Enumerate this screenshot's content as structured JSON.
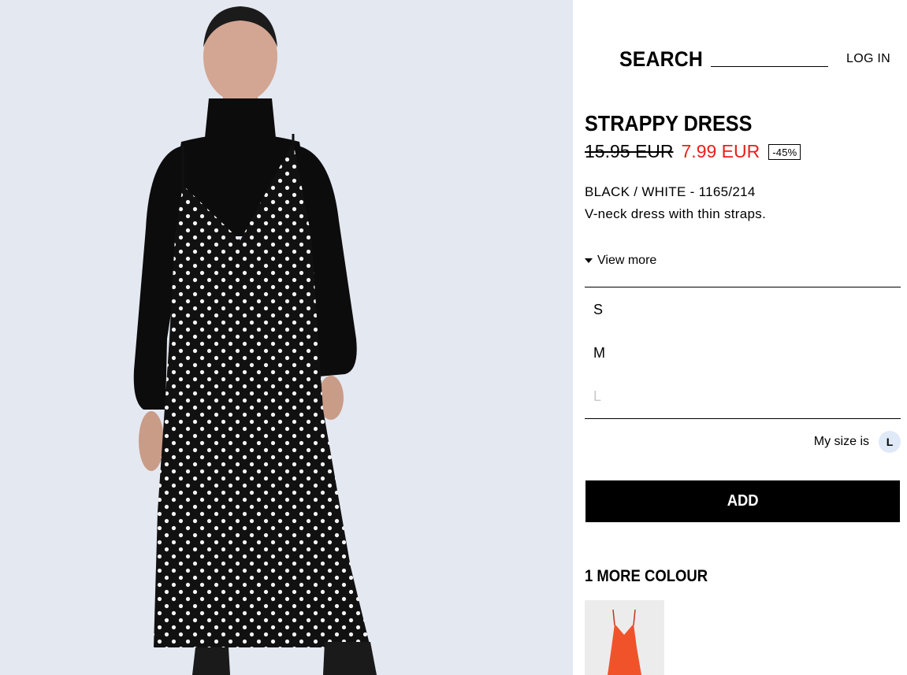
{
  "header": {
    "search_label": "SEARCH",
    "login_label": "LOG IN"
  },
  "product": {
    "title": "STRAPPY DRESS",
    "old_price": "15.95 EUR",
    "new_price": "7.99 EUR",
    "discount": "-45%",
    "color_ref": "BLACK / WHITE - 1165/214",
    "description": "V-neck dress with thin straps.",
    "view_more_label": "View more"
  },
  "sizes": [
    {
      "label": "S",
      "available": true
    },
    {
      "label": "M",
      "available": true
    },
    {
      "label": "L",
      "available": false
    }
  ],
  "my_size": {
    "label": "My size is",
    "value": "L"
  },
  "add_button_label": "ADD",
  "more_colours": {
    "heading": "1 MORE COLOUR"
  },
  "colors": {
    "sale_red": "#e8201b",
    "background_image": "#e4e8f1",
    "my_size_badge": "#dfe9f7",
    "swatch_dress": "#f0532a"
  },
  "icons": {
    "view_more": "caret-down-icon"
  }
}
